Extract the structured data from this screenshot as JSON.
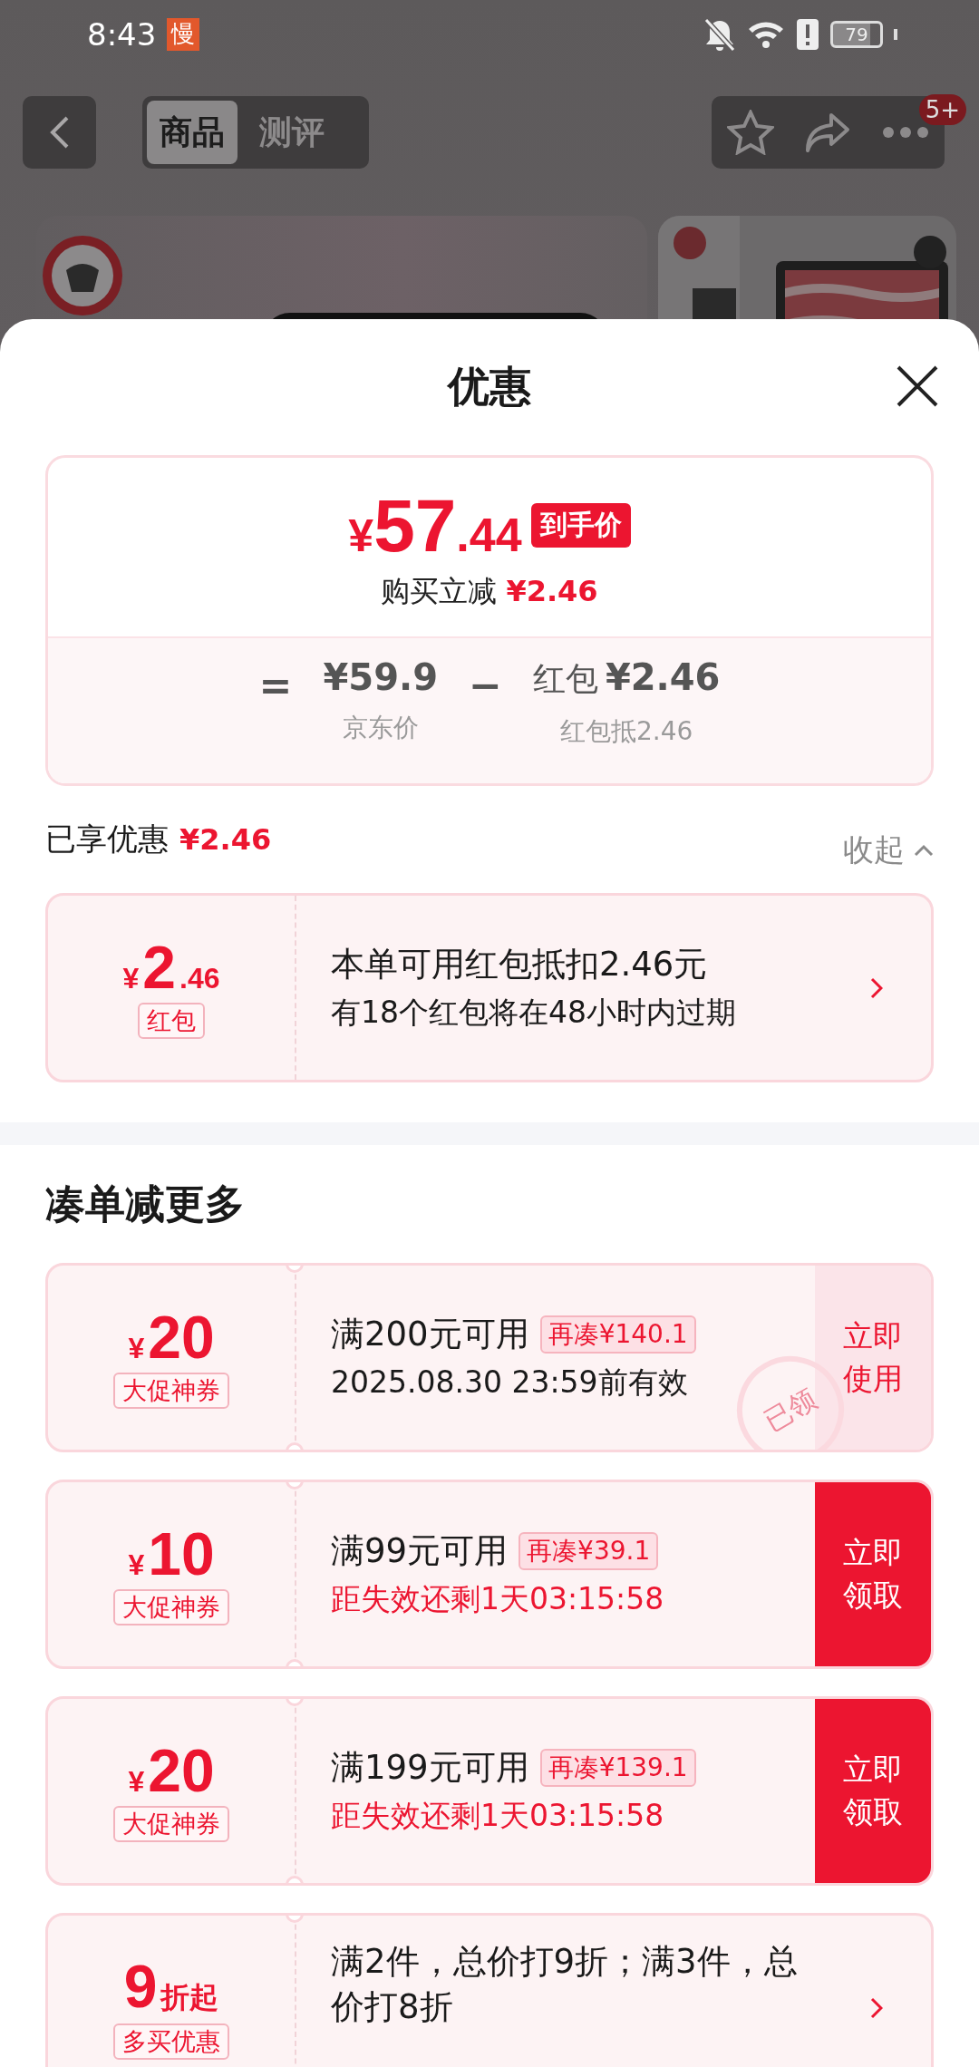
{
  "status_bar": {
    "time": "8:43",
    "app_badge": "慢",
    "battery": "79"
  },
  "nav": {
    "tabs": [
      {
        "label": "商品",
        "selected": true
      },
      {
        "label": "测评",
        "selected": false
      }
    ],
    "badge": "5+"
  },
  "sheet": {
    "title": "优惠"
  },
  "price_card": {
    "currency": "¥",
    "price_int": "57",
    "price_dec": ".44",
    "price_tag": "到手价",
    "reduce_label": "购买立减",
    "reduce_amount": "¥2.46",
    "equals": "=",
    "jd_price": "¥59.9",
    "jd_label": "京东价",
    "minus": "−",
    "packet_label": "红包",
    "packet_amount": "¥2.46",
    "packet_note": "红包抵2.46"
  },
  "enjoyed": {
    "label": "已享优惠",
    "amount": "¥2.46",
    "collapse": "收起"
  },
  "red_packet": {
    "notched": false,
    "prefix": "¥",
    "value": "2",
    "suffix": ".46",
    "tag": "红包",
    "title": "本单可用红包抵扣2.46元",
    "note": "有18个红包将在48小时内过期",
    "note_urgent": false,
    "action": {
      "kind": "arrow"
    }
  },
  "section_title": "凑单减更多",
  "coupons": [
    {
      "notched": true,
      "prefix": "¥",
      "value": "20",
      "tag": "大促神券",
      "title": "满200元可用",
      "gap": "再凑¥140.1",
      "note": "2025.08.30 23:59前有效",
      "note_urgent": false,
      "stamp": "已领",
      "action": {
        "kind": "button",
        "label": "立即使用",
        "filled": false
      }
    },
    {
      "notched": true,
      "prefix": "¥",
      "value": "10",
      "tag": "大促神券",
      "title": "满99元可用",
      "gap": "再凑¥39.1",
      "note": "距失效还剩1天03:15:58",
      "note_urgent": true,
      "action": {
        "kind": "button",
        "label": "立即领取",
        "filled": true
      }
    },
    {
      "notched": true,
      "prefix": "¥",
      "value": "20",
      "tag": "大促神券",
      "title": "满199元可用",
      "gap": "再凑¥139.1",
      "note": "距失效还剩1天03:15:58",
      "note_urgent": true,
      "action": {
        "kind": "button",
        "label": "立即领取",
        "filled": true
      }
    },
    {
      "notched": true,
      "value": "9",
      "suffix": "折起",
      "tag": "多买优惠",
      "title": "满2件，总价打9折；满3件，总价打8折",
      "action": {
        "kind": "arrow"
      }
    }
  ]
}
